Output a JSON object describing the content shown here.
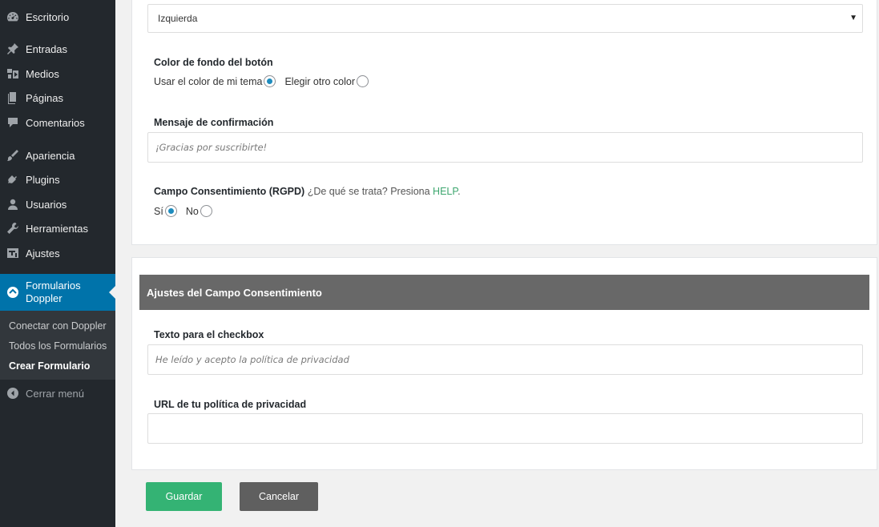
{
  "sidebar": {
    "items": [
      {
        "label": "Escritorio",
        "icon": "dashboard-icon"
      },
      {
        "label": "Entradas",
        "icon": "pin-icon"
      },
      {
        "label": "Medios",
        "icon": "media-icon"
      },
      {
        "label": "Páginas",
        "icon": "pages-icon"
      },
      {
        "label": "Comentarios",
        "icon": "comments-icon"
      },
      {
        "label": "Apariencia",
        "icon": "appearance-icon"
      },
      {
        "label": "Plugins",
        "icon": "plugins-icon"
      },
      {
        "label": "Usuarios",
        "icon": "users-icon"
      },
      {
        "label": "Herramientas",
        "icon": "tools-icon"
      },
      {
        "label": "Ajustes",
        "icon": "settings-icon"
      }
    ],
    "current": {
      "label_line1": "Formularios",
      "label_line2": "Doppler",
      "icon": "doppler-icon"
    },
    "submenu": [
      {
        "label": "Conectar con Doppler"
      },
      {
        "label": "Todos los Formularios"
      },
      {
        "label": "Crear Formulario",
        "active": true
      }
    ],
    "collapse_label": "Cerrar menú"
  },
  "form": {
    "alignment_select": {
      "value": "Izquierda"
    },
    "button_bg": {
      "label": "Color de fondo del botón",
      "option_theme": "Usar el color de mi tema",
      "option_other": "Elegir otro color",
      "selected": "theme"
    },
    "confirmation": {
      "label": "Mensaje de confirmación",
      "placeholder": "¡Gracias por suscribirte!"
    },
    "consent_field": {
      "label": "Campo Consentimiento (RGPD)",
      "help_text": "¿De qué se trata? Presiona",
      "help_link": "HELP",
      "help_suffix": ".",
      "option_yes": "Sí",
      "option_no": "No",
      "selected": "yes"
    }
  },
  "consent_settings": {
    "header": "Ajustes del Campo Consentimiento",
    "checkbox_text": {
      "label": "Texto para el checkbox",
      "placeholder": "He leído y acepto la política de privacidad"
    },
    "privacy_url": {
      "label": "URL de tu política de privacidad",
      "value": ""
    }
  },
  "actions": {
    "save": "Guardar",
    "cancel": "Cancelar"
  },
  "colors": {
    "sidebar_bg": "#23282d",
    "active_menu": "#0073aa",
    "save_button": "#34b374",
    "cancel_button": "#5f5f5f",
    "section_header": "#686868",
    "help_link": "#3ca66e",
    "radio_checked": "#1e8cbe"
  }
}
